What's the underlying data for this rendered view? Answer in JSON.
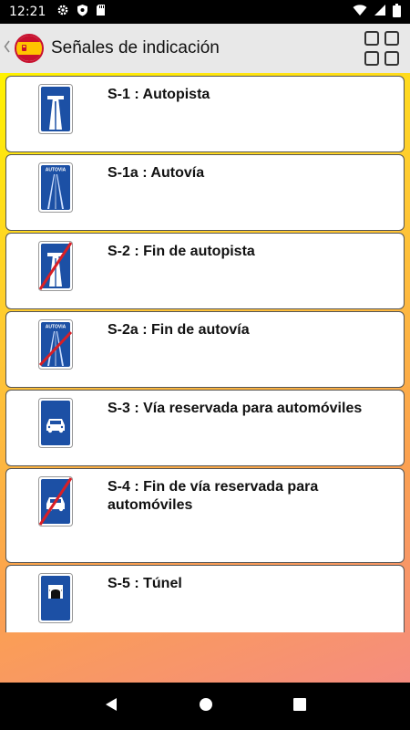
{
  "status_bar": {
    "time": "12:21",
    "icons": [
      "gear-icon",
      "shield-icon",
      "sd-card-icon"
    ],
    "right_icons": [
      "wifi-icon",
      "signal-icon",
      "battery-icon"
    ]
  },
  "app_bar": {
    "title": "Señales de indicación",
    "back_icon": "chevron-left-icon",
    "flag_icon": "spain-flag-icon",
    "menu_icon": "grid-icon"
  },
  "signs": [
    {
      "label": "S-1 : Autopista",
      "icon": "autopista-sign-icon"
    },
    {
      "label": "S-1a : Autovía",
      "icon": "autovia-sign-icon",
      "sign_text": "AUTOVIA"
    },
    {
      "label": "S-2 : Fin de autopista",
      "icon": "fin-autopista-sign-icon"
    },
    {
      "label": "S-2a : Fin de autovía",
      "icon": "fin-autovia-sign-icon",
      "sign_text": "AUTOVIA"
    },
    {
      "label": "S-3 : Vía reservada para automóviles",
      "icon": "via-automoviles-sign-icon"
    },
    {
      "label": "S-4 : Fin de vía reservada para automóviles",
      "icon": "fin-via-automoviles-sign-icon"
    },
    {
      "label": "S-5 : Túnel",
      "icon": "tunel-sign-icon"
    }
  ],
  "colors": {
    "sign_blue": "#1c50a5",
    "strike_red": "#d81f26",
    "app_bar_bg": "#e8e8e8"
  },
  "nav_bar": {
    "icons": [
      "back-triangle-icon",
      "home-circle-icon",
      "recents-square-icon"
    ]
  }
}
